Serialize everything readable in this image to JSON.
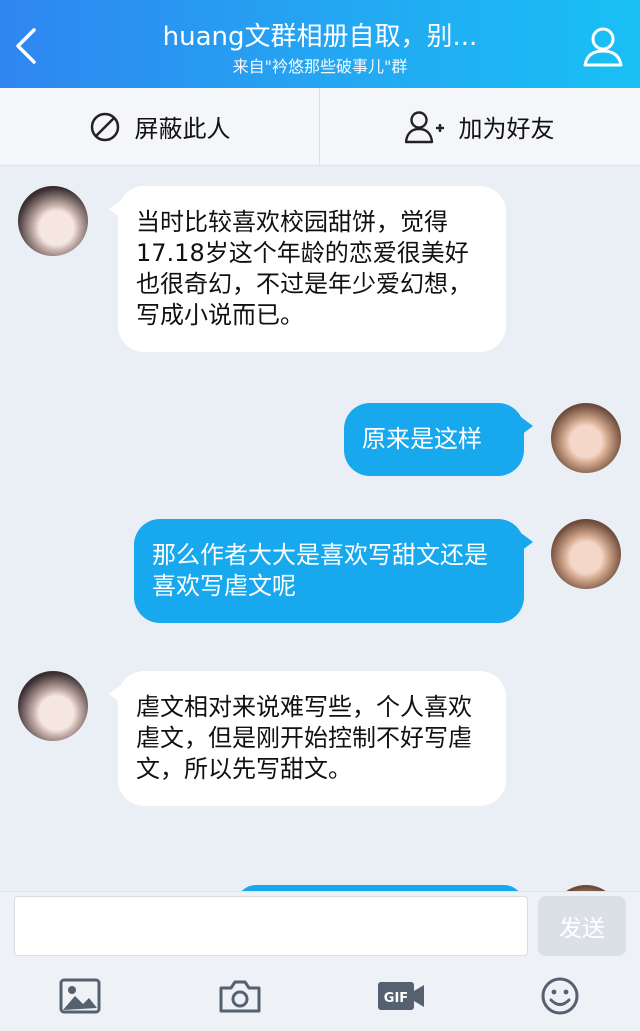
{
  "header": {
    "title": "huang文群相册自取，别...",
    "subtitle": "来自\"衿悠那些破事儿\"群",
    "back_icon": "back-arrow-icon",
    "profile_icon": "person-icon"
  },
  "actions": {
    "block_label": "屏蔽此人",
    "add_friend_label": "加为好友"
  },
  "messages": [
    {
      "side": "in",
      "text": "当时比较喜欢校园甜饼，觉得17.18岁这个年龄的恋爱很美好也很奇幻，不过是年少爱幻想，写成小说而已。"
    },
    {
      "side": "out",
      "text": "原来是这样"
    },
    {
      "side": "out",
      "text": "那么作者大大是喜欢写甜文还是喜欢写虐文呢"
    },
    {
      "side": "in",
      "text": "虐文相对来说难写些，个人喜欢虐文，但是刚开始控制不好写虐文，所以先写甜文。"
    }
  ],
  "composer": {
    "input_value": "",
    "send_label": "发送",
    "tools": [
      "image-icon",
      "camera-icon",
      "gif-icon",
      "emoji-icon"
    ]
  },
  "colors": {
    "header_gradient_start": "#2f86f0",
    "header_gradient_end": "#19c0f5",
    "outgoing_bubble": "#17a8ee",
    "incoming_bubble": "#ffffff",
    "chat_background": "#eaeff5"
  }
}
